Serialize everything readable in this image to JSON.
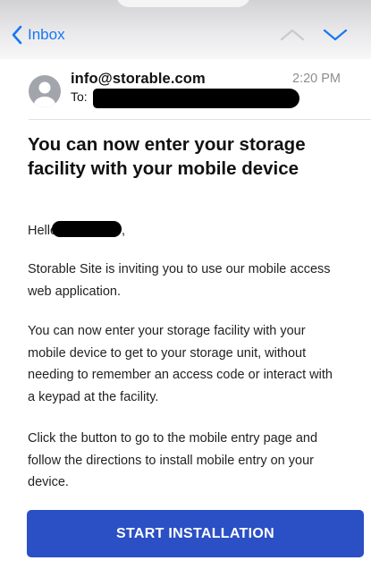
{
  "nav": {
    "back_label": "Inbox"
  },
  "email": {
    "sender": "info@storable.com",
    "time": "2:20 PM",
    "to_label": "To:",
    "subject": "You can now enter your storage facility with your mobile device",
    "greeting": "Hello",
    "greeting_suffix": ",",
    "paragraphs": [
      "Storable Site is inviting you to use our mobile access web application.",
      "You can now enter your storage facility with your mobile device to get to your storage unit, without needing to remember an access code or interact with a keypad at the facility.",
      "Click the button to go to the mobile entry page and follow the directions to install mobile entry on your device."
    ],
    "cta_label": "START INSTALLATION"
  },
  "icons": {
    "back": "chevron-left-icon",
    "previous": "chevron-up-icon",
    "next": "chevron-down-icon",
    "avatar": "person-avatar-icon"
  },
  "colors": {
    "accent": "#1877f2",
    "cta_background": "#2b4fc4",
    "muted": "#8e8e93"
  }
}
